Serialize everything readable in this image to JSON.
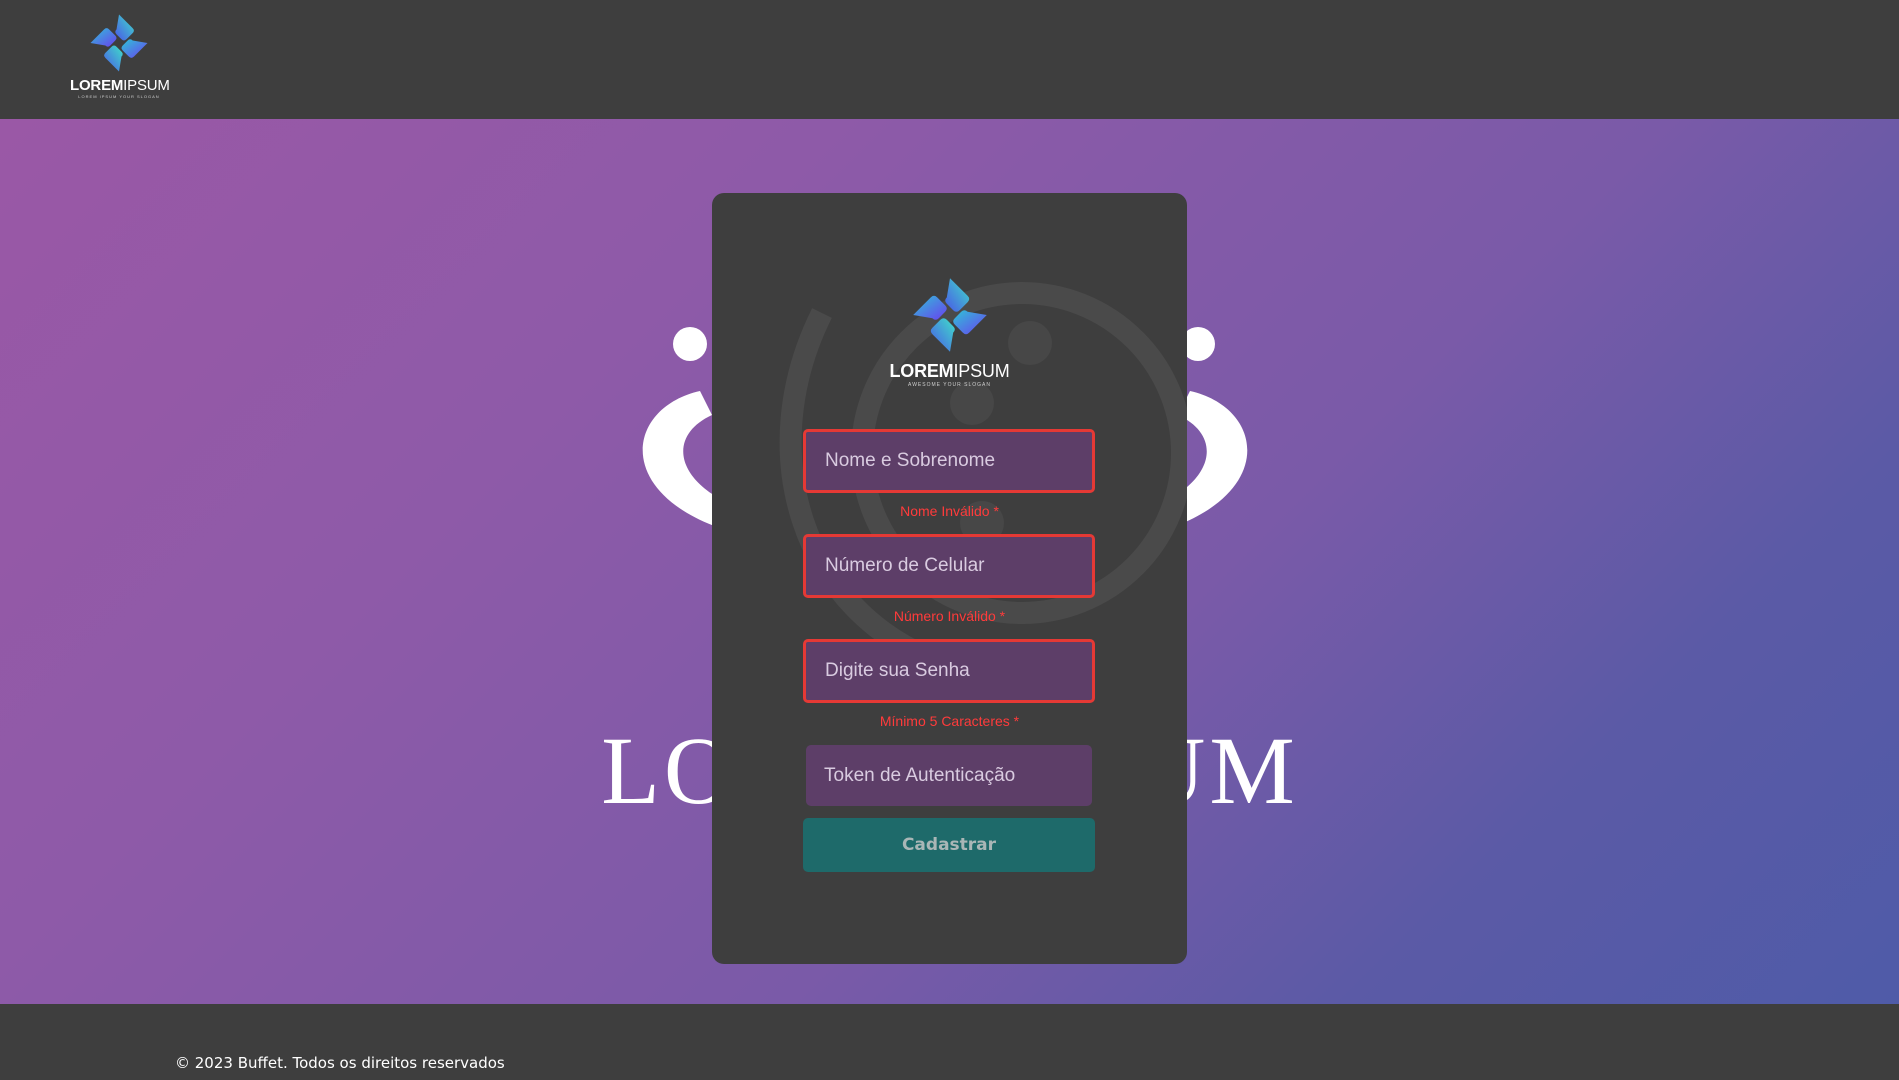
{
  "header": {
    "logo": {
      "word_bold": "LOREM",
      "word_thin": "IPSUM",
      "slogan": "LOREM IPSUM YOUR SLOGAN"
    }
  },
  "background": {
    "wordmark": "LOREM IPSUM"
  },
  "card": {
    "logo": {
      "word_bold": "LOREM",
      "word_thin": "IPSUM",
      "slogan": "AWESOME YOUR SLOGAN"
    },
    "form": {
      "name": {
        "placeholder": "Nome e Sobrenome",
        "value": "",
        "error": "Nome Inválido *"
      },
      "phone": {
        "placeholder": "Número de Celular",
        "value": "",
        "error": "Número Inválido *"
      },
      "password": {
        "placeholder": "Digite sua Senha",
        "value": "",
        "error": "Mínimo 5 Caracteres *"
      },
      "token": {
        "placeholder": "Token de Autenticação",
        "value": ""
      },
      "submit_label": "Cadastrar"
    }
  },
  "footer": {
    "copyright": "© 2023 Buffet. Todos os direitos reservados"
  },
  "colors": {
    "header_bg": "#3e3e3e",
    "card_bg": "#3e3e3e",
    "input_bg": "#5d3e68",
    "error": "#e53935",
    "button_bg": "#1e6a6a",
    "gradient_start": "#9a58a6",
    "gradient_end": "#4f5ba8"
  }
}
